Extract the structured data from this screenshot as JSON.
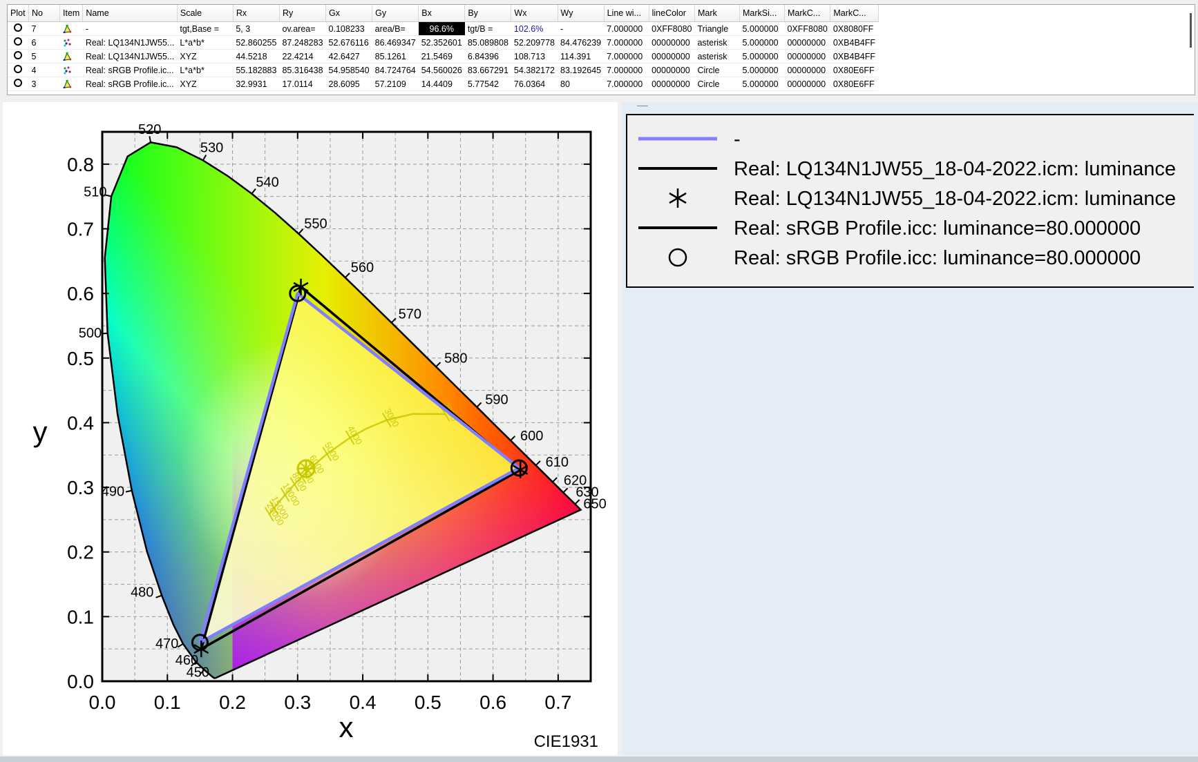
{
  "table": {
    "columns": [
      "Plot",
      "No",
      "Item",
      "Name",
      "Scale",
      "Rx",
      "Ry",
      "Gx",
      "Gy",
      "Bx",
      "By",
      "Wx",
      "Wy",
      "Line wi...",
      "lineColor",
      "Mark",
      "MarkSi...",
      "MarkC...",
      "MarkC..."
    ],
    "rows": [
      {
        "no": "7",
        "item_icon": "triangle-item-icon",
        "name": "-",
        "scale": "tgt,Base =",
        "rx": "5, 3",
        "ry": "ov.area=",
        "gx": "0.108233",
        "gy": "area/B=",
        "bx": "96.6%",
        "by": "tgt/B =",
        "wx": "102.6%",
        "wy": "-",
        "line_width": "7.000000",
        "line_color": "0XFF8080",
        "mark": "Triangle",
        "mark_size": "5.000000",
        "mark_c1": "0XFF8080",
        "mark_c2": "0X8080FF"
      },
      {
        "no": "6",
        "item_icon": "scatter-item-icon",
        "name": "Real: LQ134N1JW55...",
        "scale": "L*a*b*",
        "rx": "52.860255",
        "ry": "87.248283",
        "gx": "52.676116",
        "gy": "86.469347",
        "bx": "52.352601",
        "by": "85.089808",
        "wx": "52.209778",
        "wy": "84.476239",
        "line_width": "7.000000",
        "line_color": "00000000",
        "mark": "asterisk",
        "mark_size": "5.000000",
        "mark_c1": "00000000",
        "mark_c2": "0XB4B4FF"
      },
      {
        "no": "5",
        "item_icon": "triangle-item-icon",
        "name": "Real: LQ134N1JW55...",
        "scale": "XYZ",
        "rx": "44.5218",
        "ry": "22.4214",
        "gx": "42.6427",
        "gy": "85.1261",
        "bx": "21.5469",
        "by": "6.84396",
        "wx": "108.713",
        "wy": "114.391",
        "line_width": "7.000000",
        "line_color": "00000000",
        "mark": "asterisk",
        "mark_size": "5.000000",
        "mark_c1": "00000000",
        "mark_c2": "0XB4B4FF"
      },
      {
        "no": "4",
        "item_icon": "scatter-item-icon",
        "name": "Real: sRGB Profile.ic...",
        "scale": "L*a*b*",
        "rx": "55.182883",
        "ry": "85.316438",
        "gx": "54.958540",
        "gy": "84.724764",
        "bx": "54.560026",
        "by": "83.667291",
        "wx": "54.382172",
        "wy": "83.192645",
        "line_width": "7.000000",
        "line_color": "00000000",
        "mark": "Circle",
        "mark_size": "5.000000",
        "mark_c1": "00000000",
        "mark_c2": "0X80E6FF"
      },
      {
        "no": "3",
        "item_icon": "triangle-item-icon",
        "name": "Real: sRGB Profile.ic...",
        "scale": "XYZ",
        "rx": "32.9931",
        "ry": "17.0114",
        "gx": "28.6095",
        "gy": "57.2109",
        "bx": "14.4409",
        "by": "5.77542",
        "wx": "76.0364",
        "wy": "80",
        "line_width": "7.000000",
        "line_color": "00000000",
        "mark": "Circle",
        "mark_size": "5.000000",
        "mark_c1": "00000000",
        "mark_c2": "0X80E6FF"
      }
    ]
  },
  "chart": {
    "xlabel": "x",
    "ylabel": "y",
    "corner_label": "CIE1931",
    "xticks": [
      "0.0",
      "0.1",
      "0.2",
      "0.3",
      "0.4",
      "0.5",
      "0.6",
      "0.7"
    ],
    "yticks": [
      "0.0",
      "0.1",
      "0.2",
      "0.3",
      "0.4",
      "0.5",
      "0.6",
      "0.7",
      "0.8"
    ],
    "wavelength_labels": [
      "450",
      "460",
      "470",
      "480",
      "490",
      "500",
      "510",
      "520",
      "530",
      "540",
      "550",
      "560",
      "570",
      "580",
      "590",
      "600",
      "610",
      "620",
      "630",
      "650"
    ],
    "cct_labels": [
      "2000",
      "3000",
      "4000",
      "5000",
      "6000",
      "7000",
      "8000",
      "10000",
      "15000",
      "20000"
    ],
    "colors": {
      "target_line": "#8080ff",
      "gamut_line": "#000000",
      "planck": "#c8c800"
    }
  },
  "chart_data": {
    "type": "scatter",
    "xlim": [
      0,
      0.75
    ],
    "ylim": [
      0,
      0.85
    ],
    "grid": true,
    "series": [
      {
        "name": "-",
        "points": [
          [
            0.64,
            0.33
          ],
          [
            0.3,
            0.6
          ],
          [
            0.15,
            0.06
          ]
        ]
      },
      {
        "name": "Real: LQ134N1JW55_18-04-2022.icm: luminance",
        "points": [
          [
            0.642,
            0.327
          ],
          [
            0.305,
            0.61
          ],
          [
            0.152,
            0.05
          ]
        ]
      },
      {
        "name": "Real: sRGB Profile.icc: luminance=80.000000",
        "points": [
          [
            0.64,
            0.33
          ],
          [
            0.3,
            0.6
          ],
          [
            0.15,
            0.06
          ]
        ]
      }
    ],
    "white_point": [
      0.313,
      0.329
    ]
  },
  "legend": {
    "entries": [
      {
        "symbol": "line-blue",
        "label": "-"
      },
      {
        "symbol": "line-black",
        "label": "Real: LQ134N1JW55_18-04-2022.icm: luminance"
      },
      {
        "symbol": "asterisk",
        "label": "Real: LQ134N1JW55_18-04-2022.icm: luminance"
      },
      {
        "symbol": "line-black",
        "label": "Real: sRGB Profile.icc: luminance=80.000000"
      },
      {
        "symbol": "circle",
        "label": "Real: sRGB Profile.icc: luminance=80.000000"
      }
    ]
  }
}
